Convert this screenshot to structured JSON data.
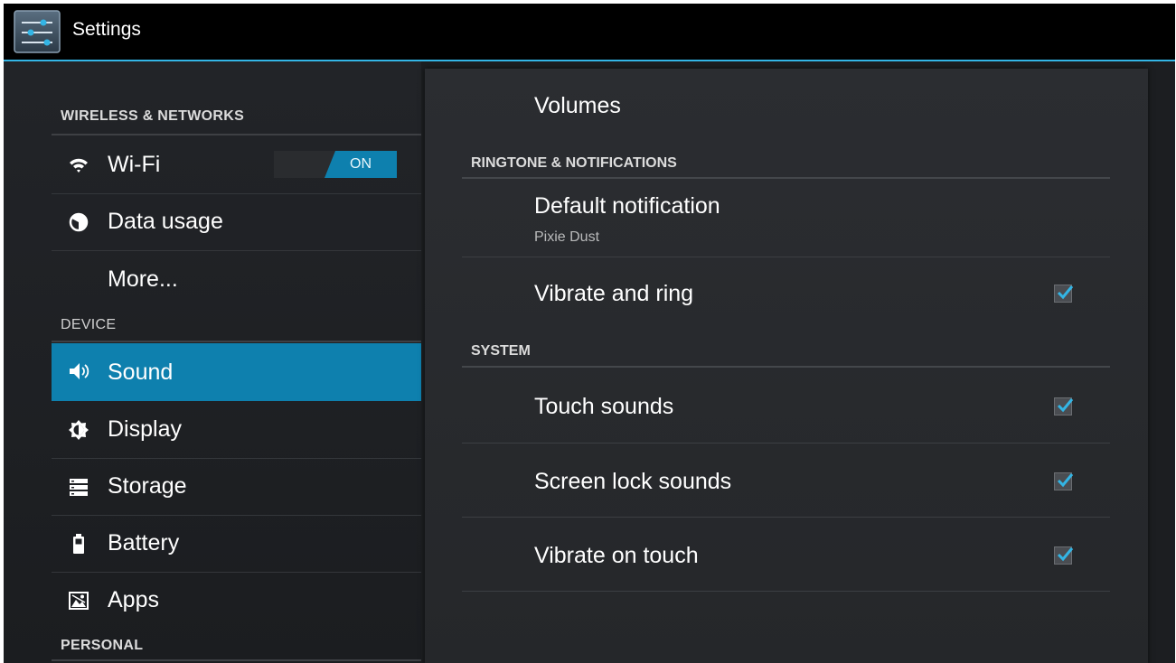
{
  "app": {
    "title": "Settings",
    "icon": "settings-sliders-icon",
    "accent_color": "#33b5e5",
    "selected_color": "#0e80ae"
  },
  "sidebar": {
    "sections": [
      {
        "header": "WIRELESS & NETWORKS"
      },
      {
        "header": "DEVICE"
      },
      {
        "header": "PERSONAL"
      }
    ],
    "items": [
      {
        "label": "Wi-Fi",
        "icon": "wifi-icon",
        "toggle": "ON"
      },
      {
        "label": "Data usage",
        "icon": "data-usage-icon"
      },
      {
        "label": "More...",
        "icon": ""
      },
      {
        "label": "Sound",
        "icon": "speaker-icon",
        "selected": true
      },
      {
        "label": "Display",
        "icon": "brightness-icon"
      },
      {
        "label": "Storage",
        "icon": "storage-icon"
      },
      {
        "label": "Battery",
        "icon": "battery-icon"
      },
      {
        "label": "Apps",
        "icon": "apps-icon"
      }
    ]
  },
  "detail": {
    "volumes": "Volumes",
    "ringtone_header": "RINGTONE & NOTIFICATIONS",
    "default_notification": {
      "title": "Default notification",
      "summary": "Pixie Dust"
    },
    "vibrate_ring": {
      "title": "Vibrate and ring",
      "checked": true
    },
    "system_header": "SYSTEM",
    "touch_sounds": {
      "title": "Touch sounds",
      "checked": true
    },
    "screen_lock_sounds": {
      "title": "Screen lock sounds",
      "checked": true
    },
    "vibrate_touch": {
      "title": "Vibrate on touch",
      "checked": true
    }
  }
}
